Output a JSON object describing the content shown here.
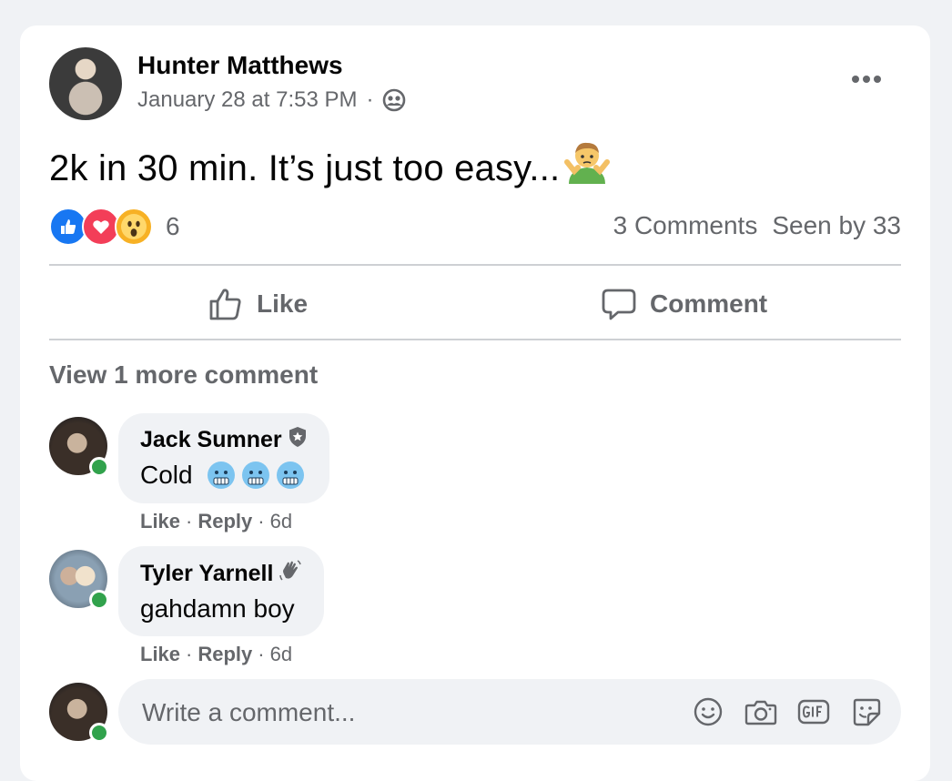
{
  "post": {
    "author": "Hunter Matthews",
    "timestamp": "January 28 at 7:53 PM",
    "separator": "·",
    "text": "2k in 30 min. It’s just too easy...",
    "emoji_icon": "shrug-emoji-icon",
    "audience_icon": "friends-icon",
    "more_label": "•••"
  },
  "reactions": {
    "types": [
      "like",
      "love",
      "wow"
    ],
    "count": "6"
  },
  "stats": {
    "comments": "3 Comments",
    "seen": "Seen by 33"
  },
  "actions": {
    "like": "Like",
    "comment": "Comment"
  },
  "comments_section": {
    "view_more": "View 1 more comment",
    "comments": [
      {
        "name": "Jack Sumner",
        "badge_icon": "shield-badge-icon",
        "text": "Cold",
        "emoji": "cold-face-emoji-icon",
        "like": "Like",
        "reply": "Reply",
        "sep": "·",
        "time": "6d"
      },
      {
        "name": "Tyler Yarnell",
        "badge_icon": "wave-badge-icon",
        "text": "gahdamn boy",
        "like": "Like",
        "reply": "Reply",
        "sep": "·",
        "time": "6d"
      }
    ]
  },
  "composer": {
    "placeholder": "Write a comment...",
    "tools": [
      "emoji-icon",
      "camera-icon",
      "gif-icon",
      "sticker-icon"
    ]
  },
  "colors": {
    "secondary_text": "#65676b",
    "like_blue": "#1877f2",
    "love_red": "#f33e58",
    "wow_yellow": "#f7b125",
    "online_green": "#31a24c",
    "bubble_bg": "#f0f2f5"
  }
}
